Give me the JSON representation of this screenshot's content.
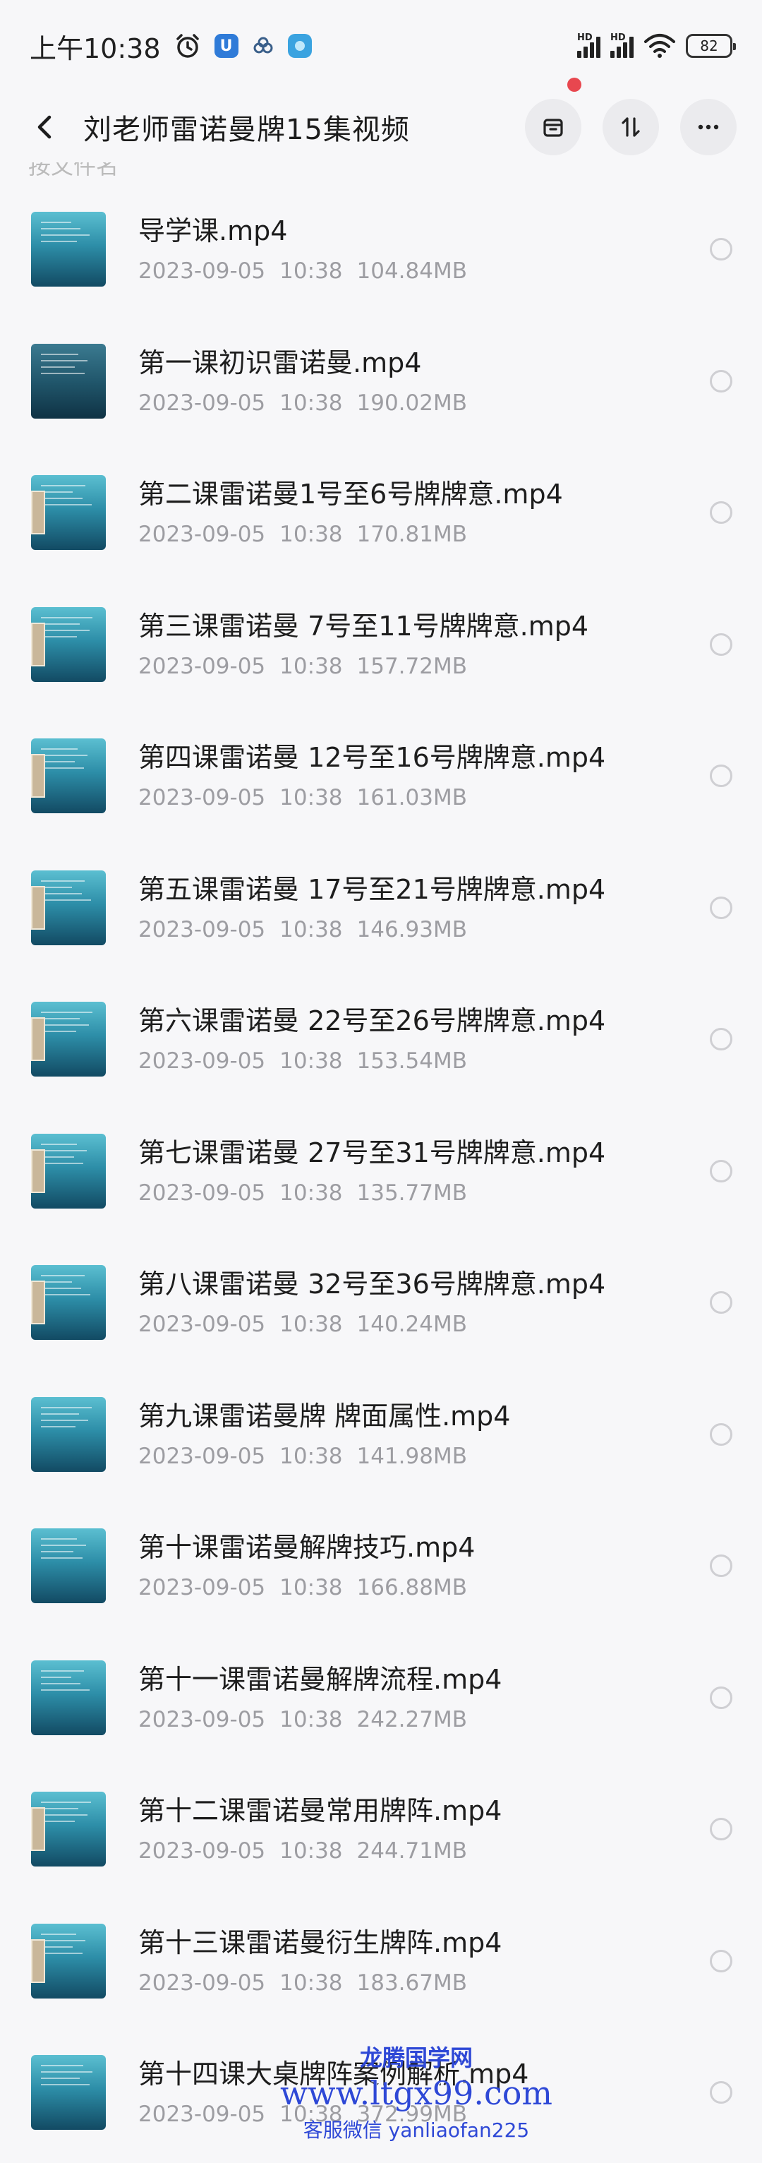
{
  "status_bar": {
    "time": "上午10:38",
    "app_badge_label": "U",
    "battery": "82",
    "network_label_1": "HD",
    "network_label_2": "HD"
  },
  "header": {
    "title": "刘老师雷诺曼牌15集视频"
  },
  "clipped_row_text": "按文件名",
  "files": [
    {
      "name": "导学课.mp4",
      "date": "2023-09-05",
      "time": "10:38",
      "size": "104.84MB"
    },
    {
      "name": "第一课初识雷诺曼.mp4",
      "date": "2023-09-05",
      "time": "10:38",
      "size": "190.02MB"
    },
    {
      "name": "第二课雷诺曼1号至6号牌牌意.mp4",
      "date": "2023-09-05",
      "time": "10:38",
      "size": "170.81MB"
    },
    {
      "name": "第三课雷诺曼 7号至11号牌牌意.mp4",
      "date": "2023-09-05",
      "time": "10:38",
      "size": "157.72MB"
    },
    {
      "name": "第四课雷诺曼 12号至16号牌牌意.mp4",
      "date": "2023-09-05",
      "time": "10:38",
      "size": "161.03MB"
    },
    {
      "name": "第五课雷诺曼 17号至21号牌牌意.mp4",
      "date": "2023-09-05",
      "time": "10:38",
      "size": "146.93MB"
    },
    {
      "name": "第六课雷诺曼 22号至26号牌牌意.mp4",
      "date": "2023-09-05",
      "time": "10:38",
      "size": "153.54MB"
    },
    {
      "name": "第七课雷诺曼 27号至31号牌牌意.mp4",
      "date": "2023-09-05",
      "time": "10:38",
      "size": "135.77MB"
    },
    {
      "name": "第八课雷诺曼 32号至36号牌牌意.mp4",
      "date": "2023-09-05",
      "time": "10:38",
      "size": "140.24MB"
    },
    {
      "name": "第九课雷诺曼牌 牌面属性.mp4",
      "date": "2023-09-05",
      "time": "10:38",
      "size": "141.98MB"
    },
    {
      "name": "第十课雷诺曼解牌技巧.mp4",
      "date": "2023-09-05",
      "time": "10:38",
      "size": "166.88MB"
    },
    {
      "name": "第十一课雷诺曼解牌流程.mp4",
      "date": "2023-09-05",
      "time": "10:38",
      "size": "242.27MB"
    },
    {
      "name": "第十二课雷诺曼常用牌阵.mp4",
      "date": "2023-09-05",
      "time": "10:38",
      "size": "244.71MB"
    },
    {
      "name": "第十三课雷诺曼衍生牌阵.mp4",
      "date": "2023-09-05",
      "time": "10:38",
      "size": "183.67MB"
    },
    {
      "name": "第十四课大桌牌阵案例解析.mp4",
      "date": "2023-09-05",
      "time": "10:38",
      "size": "372.99MB"
    }
  ],
  "watermark": {
    "line1": "龙腾国学网",
    "line2": "www.ltgx99.com",
    "line3": "客服微信 yanliaofan225"
  }
}
